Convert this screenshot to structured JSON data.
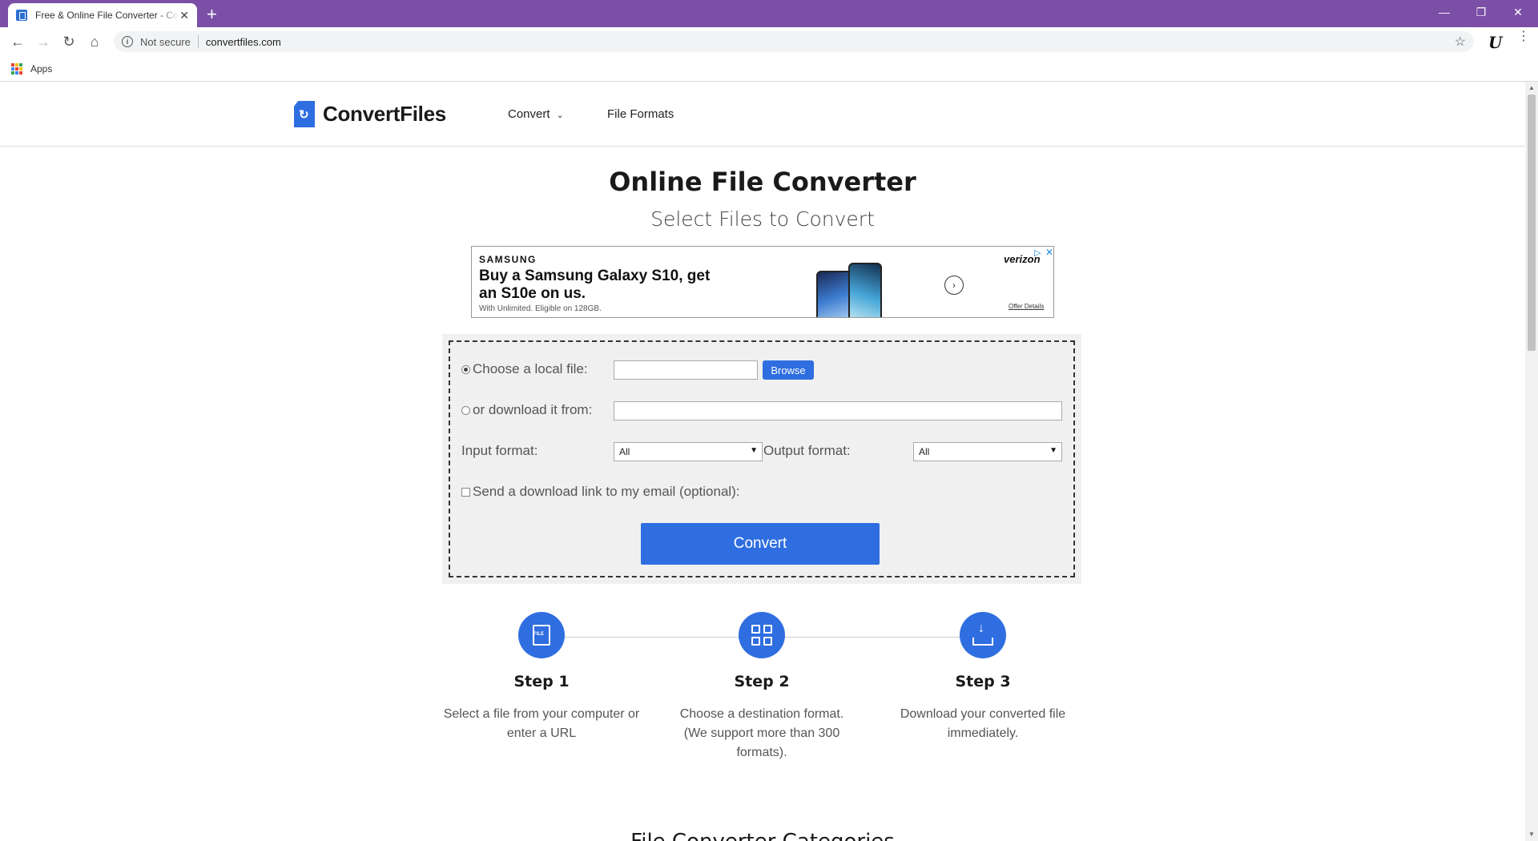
{
  "browser": {
    "tab_title": "Free & Online File Converter - Convert",
    "tab_close": "✕",
    "new_tab": "+",
    "window_controls": [
      "—",
      "❐",
      "✕"
    ],
    "nav": {
      "back": "←",
      "forward": "→",
      "reload": "↻",
      "home": "⌂"
    },
    "not_secure": "Not secure",
    "url": "convertfiles.com",
    "bookmark_star": "☆",
    "extension": "U",
    "menu": "⋮",
    "bookmarks_apps": "Apps",
    "apps_colors": [
      "#ea4335",
      "#fbbc05",
      "#34a853",
      "#4285f4",
      "#ea4335",
      "#fbbc05",
      "#34a853",
      "#4285f4",
      "#ea4335"
    ]
  },
  "site": {
    "logo_text": "ConvertFiles",
    "nav_convert": "Convert",
    "nav_convert_chevron": "⌄",
    "nav_file_formats": "File Formats",
    "brand_color": "#2f6ee0"
  },
  "hero": {
    "title": "Online File Converter",
    "subtitle": "Select Files to Convert"
  },
  "ad": {
    "brand": "SAMSUNG",
    "headline": "Buy a Samsung Galaxy S10, get an S10e on us.",
    "sub": "With Unlimited. Eligible on 128GB.",
    "arrow": "›",
    "carrier": "verizon",
    "adchoices": "▷",
    "close": "✕",
    "offer_details": "Offer Details"
  },
  "form": {
    "local_file_label": "Choose a local file:",
    "local_file_selected": true,
    "browse_label": "Browse",
    "download_label": "or download it from:",
    "url_value": "",
    "input_format_label": "Input format:",
    "input_format_value": "All",
    "output_format_label": "Output format:",
    "output_format_value": "All",
    "email_label": "Send a download link to my email (optional):",
    "email_checked": false,
    "convert_label": "Convert"
  },
  "steps": [
    {
      "title": "Step 1",
      "desc": "Select a file from your computer or enter a URL",
      "icon": "file-icon"
    },
    {
      "title": "Step 2",
      "desc": "Choose a destination format. (We support more than 300 formats).",
      "icon": "grid-icon"
    },
    {
      "title": "Step 3",
      "desc": "Download your converted file immediately.",
      "icon": "download-icon"
    }
  ],
  "categories_heading": "File Converter Categories",
  "scrollbar": {
    "up": "▲",
    "down": "▼"
  }
}
